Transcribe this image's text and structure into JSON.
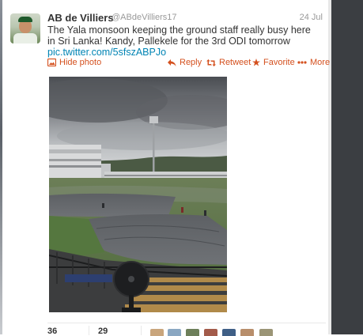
{
  "tweet": {
    "author_name": "AB de Villiers",
    "author_handle": "@ABdeVilliers17",
    "date": "24 Jul",
    "text": "The Yala monsoon keeping the ground staff really busy here in Sri Lanka! Kandy, Pallekele for the 3rd ODI tomorrow",
    "link": "pic.twitter.com/5sfszABPJo"
  },
  "actions": {
    "hide_photo": "Hide photo",
    "reply": "Reply",
    "retweet": "Retweet",
    "favorite": "Favorite",
    "more": "More"
  },
  "stats": {
    "retweets": "36",
    "favorites": "29"
  },
  "colors": {
    "link": "#0084b4",
    "action": "#d4501e",
    "text": "#333333",
    "muted": "#999999"
  }
}
